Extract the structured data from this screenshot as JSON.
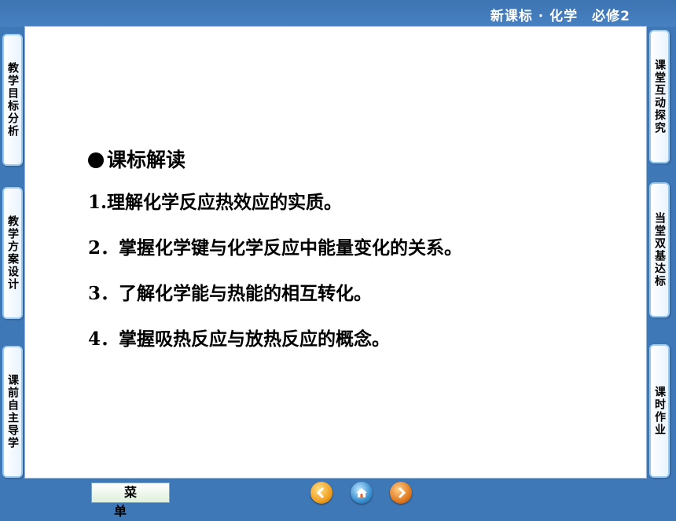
{
  "header": {
    "title": "新课标 · 化学　必修2"
  },
  "left_tabs": [
    {
      "label": "教学目标分析"
    },
    {
      "label": "教学方案设计"
    },
    {
      "label": "课前自主导学"
    }
  ],
  "right_tabs": [
    {
      "label": "课堂互动探究"
    },
    {
      "label": "当堂双基达标"
    },
    {
      "label": "课时作业"
    }
  ],
  "content": {
    "heading": "课标解读",
    "items": [
      "1.理解化学反应热效应的实质。",
      "2．掌握化学键与化学反应中能量变化的关系。",
      "3．了解化学能与热能的相互转化。",
      "4．掌握吸热反应与放热反应的概念。"
    ]
  },
  "bottom": {
    "menu_label": "菜单",
    "nav_buttons": [
      {
        "icon": "back-icon",
        "color": "#f0a020"
      },
      {
        "icon": "home-icon",
        "color": "#3a8fd0"
      },
      {
        "icon": "forward-icon",
        "color": "#e07a20"
      }
    ]
  }
}
